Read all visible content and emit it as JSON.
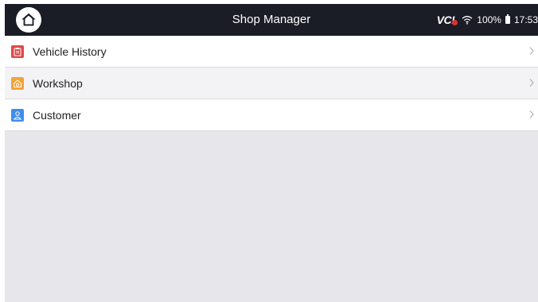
{
  "header": {
    "title": "Shop Manager",
    "home_icon": "home-icon"
  },
  "status_bar": {
    "vci_label": "VC",
    "vci_mark": "!",
    "wifi_icon": "wifi-icon",
    "battery_text": "100%",
    "battery_icon": "battery-icon",
    "time": "17:53"
  },
  "menu": {
    "items": [
      {
        "label": "Vehicle History",
        "icon": "clipboard-icon",
        "color": "#e04a4a"
      },
      {
        "label": "Workshop",
        "icon": "workshop-icon",
        "color": "#f2a33a"
      },
      {
        "label": "Customer",
        "icon": "person-icon",
        "color": "#3e8ef0"
      }
    ]
  },
  "colors": {
    "topbar": "#1a1c26",
    "content_background": "#e7e6eb",
    "vci_dot": "#e2302e"
  }
}
